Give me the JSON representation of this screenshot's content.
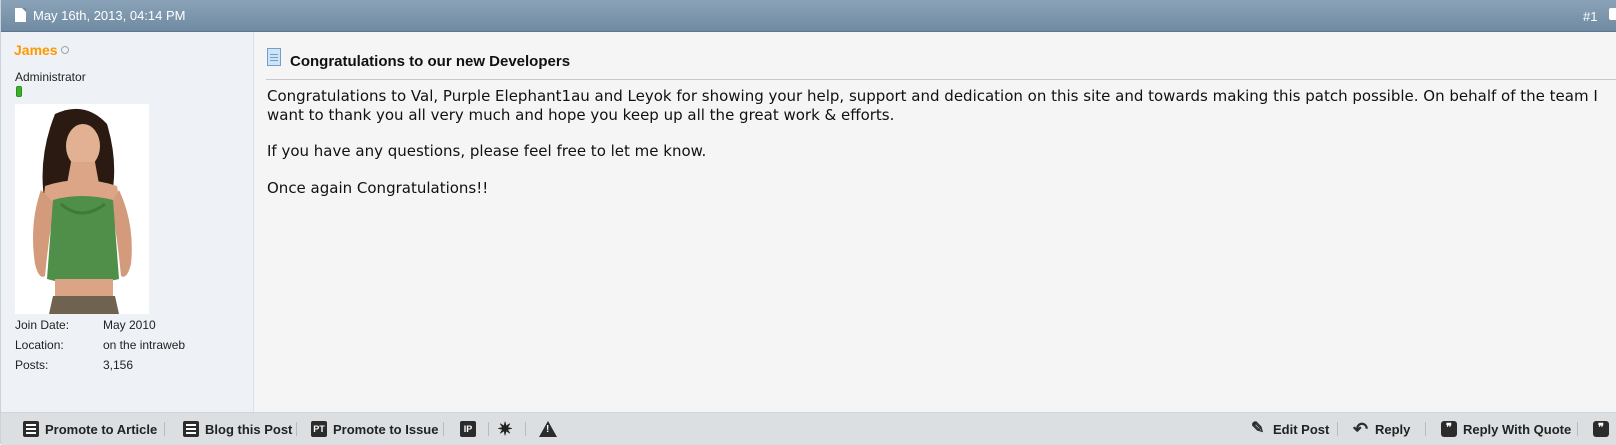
{
  "header": {
    "date": "May 16th, 2013, 04:14 PM",
    "post_number": "#1",
    "doc_icon": "document-icon"
  },
  "user": {
    "name": "James",
    "status": "offline",
    "title": "Administrator",
    "reputation_icon": "reputation-bar-icon",
    "info": [
      {
        "label": "Join Date:",
        "value": "May 2010"
      },
      {
        "label": "Location:",
        "value": "on the intraweb"
      },
      {
        "label": "Posts:",
        "value": "3,156"
      }
    ]
  },
  "post": {
    "title": "Congratulations to our new Developers",
    "paragraphs": [
      "Congratulations to Val, Purple Elephant1au and Leyok for showing your help, support and dedication on this site and towards making this patch possible. On behalf of the team I want to thank you all very much and hope you keep up all the great work & efforts.",
      "If you have any questions, please feel free to let me know.",
      "Once again Congratulations!!"
    ]
  },
  "footer": {
    "left_actions": [
      {
        "label": "Promote to Article",
        "icon": "article-icon"
      },
      {
        "label": "Blog this Post",
        "icon": "blog-icon"
      },
      {
        "label": "Promote to Issue",
        "icon": "issue-icon"
      }
    ],
    "icon_actions": [
      {
        "icon": "ip-icon",
        "text": "IP"
      },
      {
        "icon": "infraction-icon"
      },
      {
        "icon": "report-icon"
      }
    ],
    "right_actions": [
      {
        "label": "Edit Post",
        "icon": "pencil-icon"
      },
      {
        "label": "Reply",
        "icon": "reply-icon"
      },
      {
        "label": "Reply With Quote",
        "icon": "quote-icon"
      }
    ]
  },
  "colors": {
    "header_bar": "#7d97ad",
    "username": "#ff9900",
    "sidebar_bg": "#eef2f6",
    "content_bg": "#f5f5f5",
    "footer_bg": "#dcdfe2"
  }
}
